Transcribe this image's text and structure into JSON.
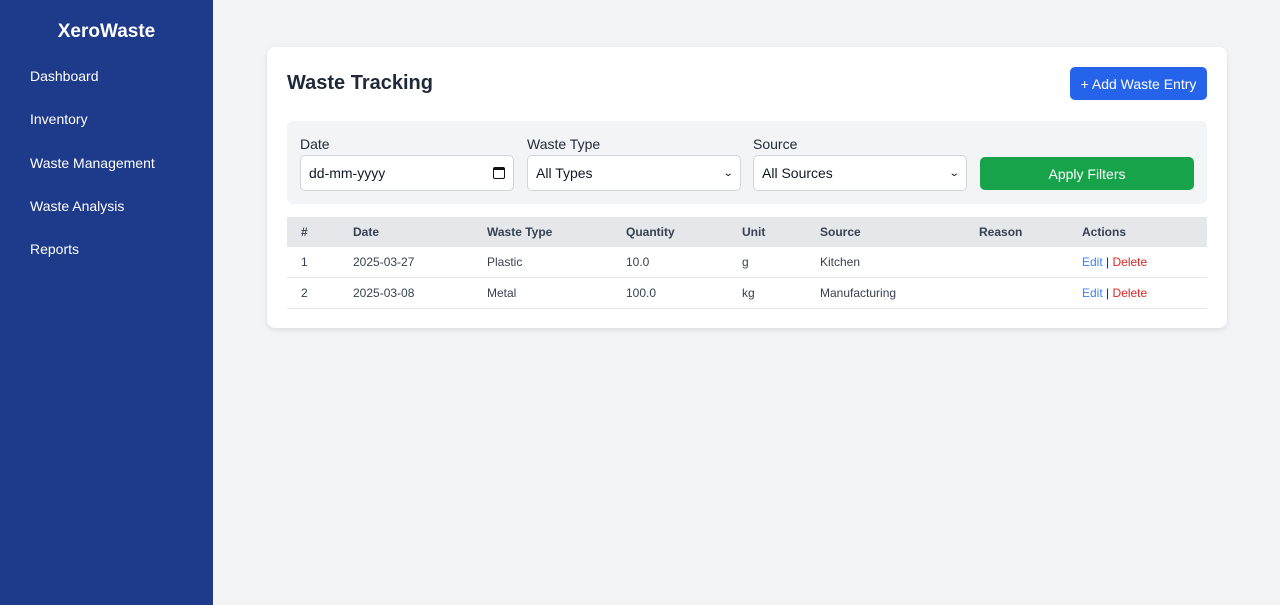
{
  "app": {
    "name": "XeroWaste"
  },
  "sidebar": {
    "items": [
      {
        "label": "Dashboard"
      },
      {
        "label": "Inventory"
      },
      {
        "label": "Waste Management"
      },
      {
        "label": "Waste Analysis"
      },
      {
        "label": "Reports"
      }
    ]
  },
  "page": {
    "title": "Waste Tracking",
    "add_button": "+ Add Waste Entry"
  },
  "filters": {
    "date_label": "Date",
    "date_placeholder": "dd-mm-yyyy",
    "type_label": "Waste Type",
    "type_value": "All Types",
    "source_label": "Source",
    "source_value": "All Sources",
    "apply_button": "Apply Filters"
  },
  "table": {
    "columns": [
      "#",
      "Date",
      "Waste Type",
      "Quantity",
      "Unit",
      "Source",
      "Reason",
      "Actions"
    ],
    "rows": [
      {
        "num": "1",
        "date": "2025-03-27",
        "type": "Plastic",
        "quantity": "10.0",
        "unit": "g",
        "source": "Kitchen",
        "reason": "",
        "edit": "Edit",
        "sep": "|",
        "delete": "Delete"
      },
      {
        "num": "2",
        "date": "2025-03-08",
        "type": "Metal",
        "quantity": "100.0",
        "unit": "kg",
        "source": "Manufacturing",
        "reason": "",
        "edit": "Edit",
        "sep": "|",
        "delete": "Delete"
      }
    ]
  },
  "colors": {
    "sidebar": "#1e3a8a",
    "primary": "#2563eb",
    "success": "#16a34a",
    "danger": "#dc2626",
    "link": "#3b82f6"
  },
  "icons": {
    "date_input": "calendar-icon",
    "select": "chevron-down-icon"
  }
}
